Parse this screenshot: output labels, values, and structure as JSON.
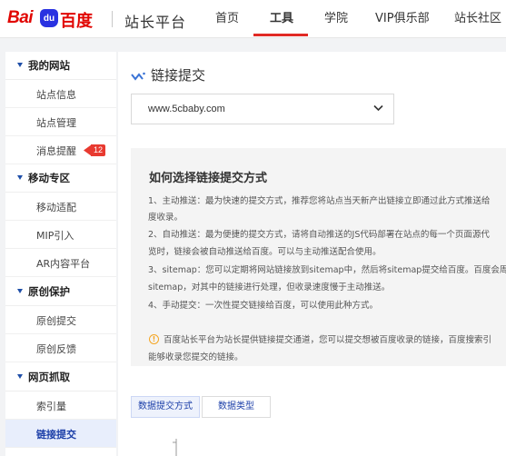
{
  "header": {
    "logo_text_1": "Bai",
    "logo_paw": "du",
    "logo_text_2": "百度",
    "site_title": "站长平台",
    "nav": [
      "首页",
      "工具",
      "学院",
      "VIP俱乐部",
      "站长社区"
    ],
    "active_nav": "工具",
    "accent_color": "#e12a25"
  },
  "sidebar": {
    "groups": [
      {
        "label": "我的网站",
        "items": [
          "站点信息",
          "站点管理",
          "消息提醒"
        ]
      },
      {
        "label": "移动专区",
        "items": [
          "移动适配",
          "MIP引入",
          "AR内容平台"
        ]
      },
      {
        "label": "原创保护",
        "items": [
          "原创提交",
          "原创反馈"
        ]
      },
      {
        "label": "网页抓取",
        "items": [
          "索引量",
          "链接提交"
        ]
      }
    ],
    "message_badge": "12",
    "active_item": "链接提交",
    "icon": "triangle-down-icon"
  },
  "main": {
    "title": "链接提交",
    "title_icon": "chart-wave-icon",
    "site_select": {
      "value": "www.5cbaby.com",
      "icon": "chevron-down-icon"
    },
    "info": {
      "heading": "如何选择链接提交方式",
      "lines": [
        "1、主动推送：最为快速的提交方式，推荐您将站点当天新产出链接立即通过此方式推送给",
        "度收录。",
        "2、自动推送：最为便捷的提交方式，请将自动推送的JS代码部署在站点的每一个页面源代",
        "览时，链接会被自动推送给百度。可以与主动推送配合使用。",
        "3、sitemap：您可以定期将网站链接放到sitemap中，然后将sitemap提交给百度。百度会周",
        "sitemap，对其中的链接进行处理，但收录速度慢于主动推送。",
        "4、手动提交：一次性提交链接给百度，可以使用此种方式。"
      ],
      "notice_lines": [
        "百度站长平台为站长提供链接提交通道，您可以提交想被百度收录的链接，百度搜索引",
        "能够收录您提交的链接。"
      ],
      "notice_icon": "info-circle-icon"
    },
    "tabs": [
      "数据提交方式",
      "数据类型"
    ],
    "active_tab": "数据提交方式"
  }
}
